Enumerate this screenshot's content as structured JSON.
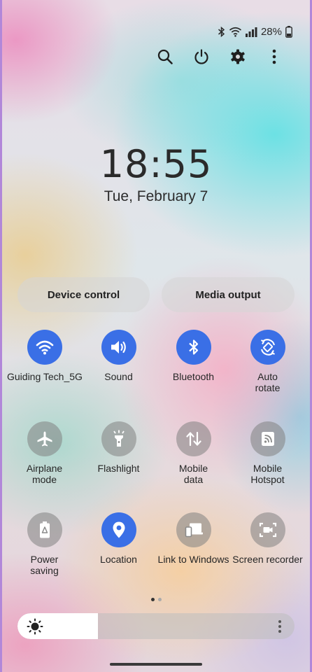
{
  "status_bar": {
    "battery_percent": "28%",
    "icons": [
      "bluetooth-icon",
      "wifi-icon",
      "signal-icon",
      "battery-icon"
    ]
  },
  "toolbar": {
    "icons": [
      "search-icon",
      "power-icon",
      "settings-gear-icon",
      "more-vertical-icon"
    ]
  },
  "clock": {
    "time": "18:55",
    "date": "Tue, February 7"
  },
  "quick_buttons": {
    "device_control": "Device control",
    "media_output": "Media output"
  },
  "tiles": [
    {
      "label": "Guiding Tech_5G",
      "icon": "wifi-icon",
      "active": true
    },
    {
      "label": "Sound",
      "icon": "volume-icon",
      "active": true
    },
    {
      "label": "Bluetooth",
      "icon": "bluetooth-icon",
      "active": true
    },
    {
      "label": "Auto\nrotate",
      "icon": "auto-rotate-icon",
      "active": true
    },
    {
      "label": "Airplane\nmode",
      "icon": "airplane-icon",
      "active": false
    },
    {
      "label": "Flashlight",
      "icon": "flashlight-icon",
      "active": false
    },
    {
      "label": "Mobile\ndata",
      "icon": "mobile-data-icon",
      "active": false
    },
    {
      "label": "Mobile\nHotspot",
      "icon": "hotspot-icon",
      "active": false
    },
    {
      "label": "Power\nsaving",
      "icon": "power-saving-icon",
      "active": false
    },
    {
      "label": "Location",
      "icon": "location-icon",
      "active": true
    },
    {
      "label": "Link to Windows",
      "icon": "link-to-windows-icon",
      "active": false
    },
    {
      "label": "Screen recorder",
      "icon": "screen-recorder-icon",
      "active": false
    }
  ],
  "pager": {
    "pages": 2,
    "current": 1
  },
  "brightness": {
    "level_fraction": 0.29
  },
  "colors": {
    "active_tile": "#3a6fe6",
    "inactive_tile": "#8c8c8c",
    "text": "#262626"
  }
}
